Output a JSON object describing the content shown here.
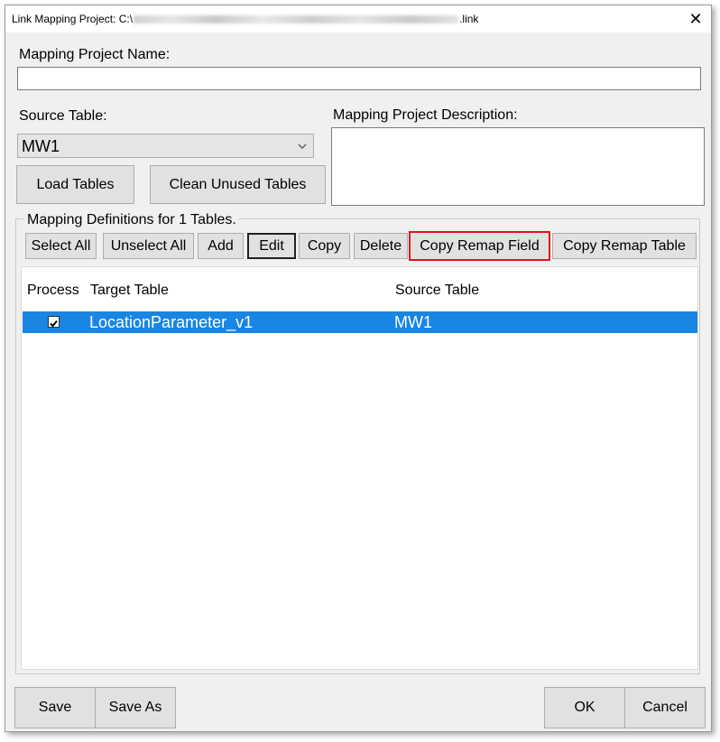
{
  "window": {
    "title_prefix": "Link Mapping Project: C:\\",
    "title_suffix": ".link",
    "close_glyph": "✕"
  },
  "form": {
    "project_name_label": "Mapping Project Name:",
    "project_name_value": "",
    "source_table_label": "Source Table:",
    "source_table_value": "MW1",
    "description_label": "Mapping Project Description:",
    "description_value": "",
    "load_tables": "Load Tables",
    "clean_unused_tables": "Clean Unused Tables"
  },
  "mapping": {
    "group_title": "Mapping Definitions for 1 Tables.",
    "toolbar": {
      "select_all": "Select All",
      "unselect_all": "Unselect All",
      "add": "Add",
      "edit": "Edit",
      "copy": "Copy",
      "delete": "Delete",
      "copy_remap_field": "Copy Remap Field",
      "copy_remap_table": "Copy Remap Table"
    },
    "columns": {
      "process": "Process",
      "target_table": "Target Table",
      "source_table": "Source Table"
    },
    "rows": [
      {
        "process": true,
        "target_table": "LocationParameter_v1",
        "source_table": "MW1"
      }
    ]
  },
  "footer": {
    "save": "Save",
    "save_as": "Save As",
    "ok": "OK",
    "cancel": "Cancel"
  },
  "colors": {
    "selection": "#1a85e2",
    "highlight_border": "#e0141e"
  },
  "icons": {
    "dropdown": "chevron-down-icon",
    "check": "checkmark-icon",
    "close": "close-icon"
  }
}
